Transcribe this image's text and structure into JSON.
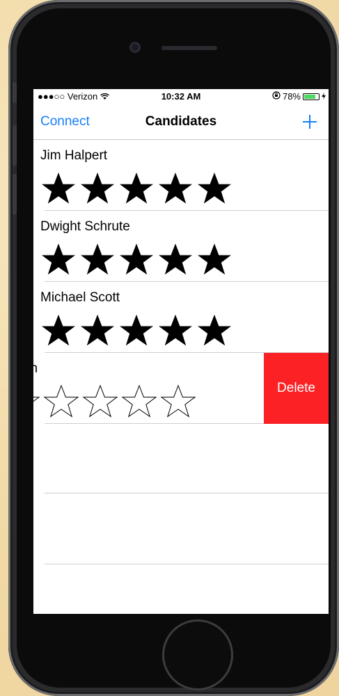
{
  "status_bar": {
    "carrier": "●●●○○ Verizon",
    "time": "10:32 AM",
    "battery_text": "78%",
    "battery_level": 0.78
  },
  "nav": {
    "left_label": "Connect",
    "title": "Candidates",
    "add_icon": "plus-icon"
  },
  "candidates": [
    {
      "name": "Jim Halpert",
      "rating": 5
    },
    {
      "name": "Dwight Schrute",
      "rating": 5
    },
    {
      "name": "Michael Scott",
      "rating": 5
    },
    {
      "name": "derson",
      "rating": 0,
      "swiped": true,
      "delete_label": "Delete"
    }
  ],
  "colors": {
    "tint": "#157efb",
    "delete": "#fc2125",
    "battery": "#4cd964"
  }
}
